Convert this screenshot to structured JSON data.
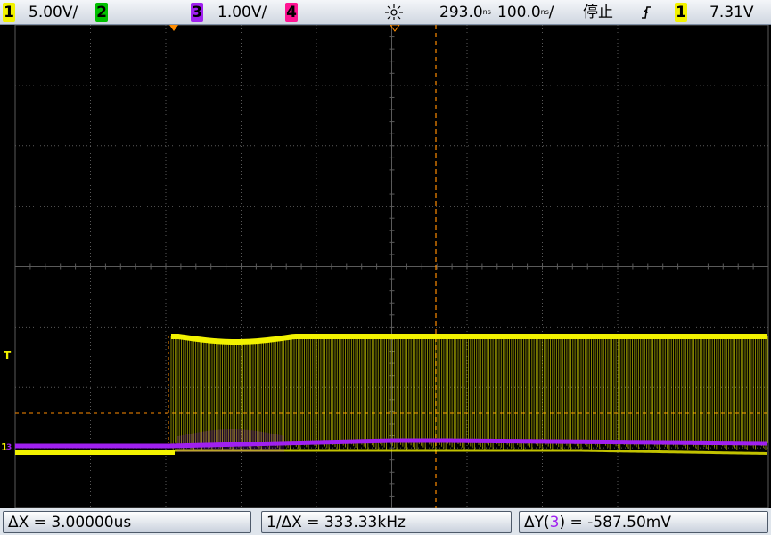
{
  "status_bar": {
    "ch1": {
      "num": "1",
      "scale": "5.00V/",
      "color": "#f2f200"
    },
    "ch2": {
      "num": "2",
      "color": "#00c000"
    },
    "ch3": {
      "num": "3",
      "scale": "1.00V/",
      "color": "#a020f0"
    },
    "ch4": {
      "num": "4",
      "color": "#ff1493"
    },
    "acq_icon": "acquire-sun-icon",
    "delay": "293.0",
    "delay_unit": "ns",
    "timebase": "100.0",
    "timebase_unit": "ns",
    "timebase_suffix": "/",
    "run_state": "停止",
    "trigger_edge_icon": "rising-edge-icon",
    "trigger_source": "1",
    "trigger_level": "7.31V"
  },
  "measurements": {
    "dx": "ΔX = 3.00000us",
    "inv_dx": "1/ΔX = 333.33kHz",
    "dy_prefix": "ΔY(",
    "dy_channel": "3",
    "dy_suffix": ") = -587.50mV"
  },
  "screen": {
    "trigger_marker_label": "T",
    "ch1_ground_label": "1",
    "ch3_ground_label": "3",
    "colors": {
      "grid": "#5a5a5a",
      "ch1": "#f2f200",
      "ch3": "#a020f0",
      "cursor": "#ff8c00"
    }
  }
}
